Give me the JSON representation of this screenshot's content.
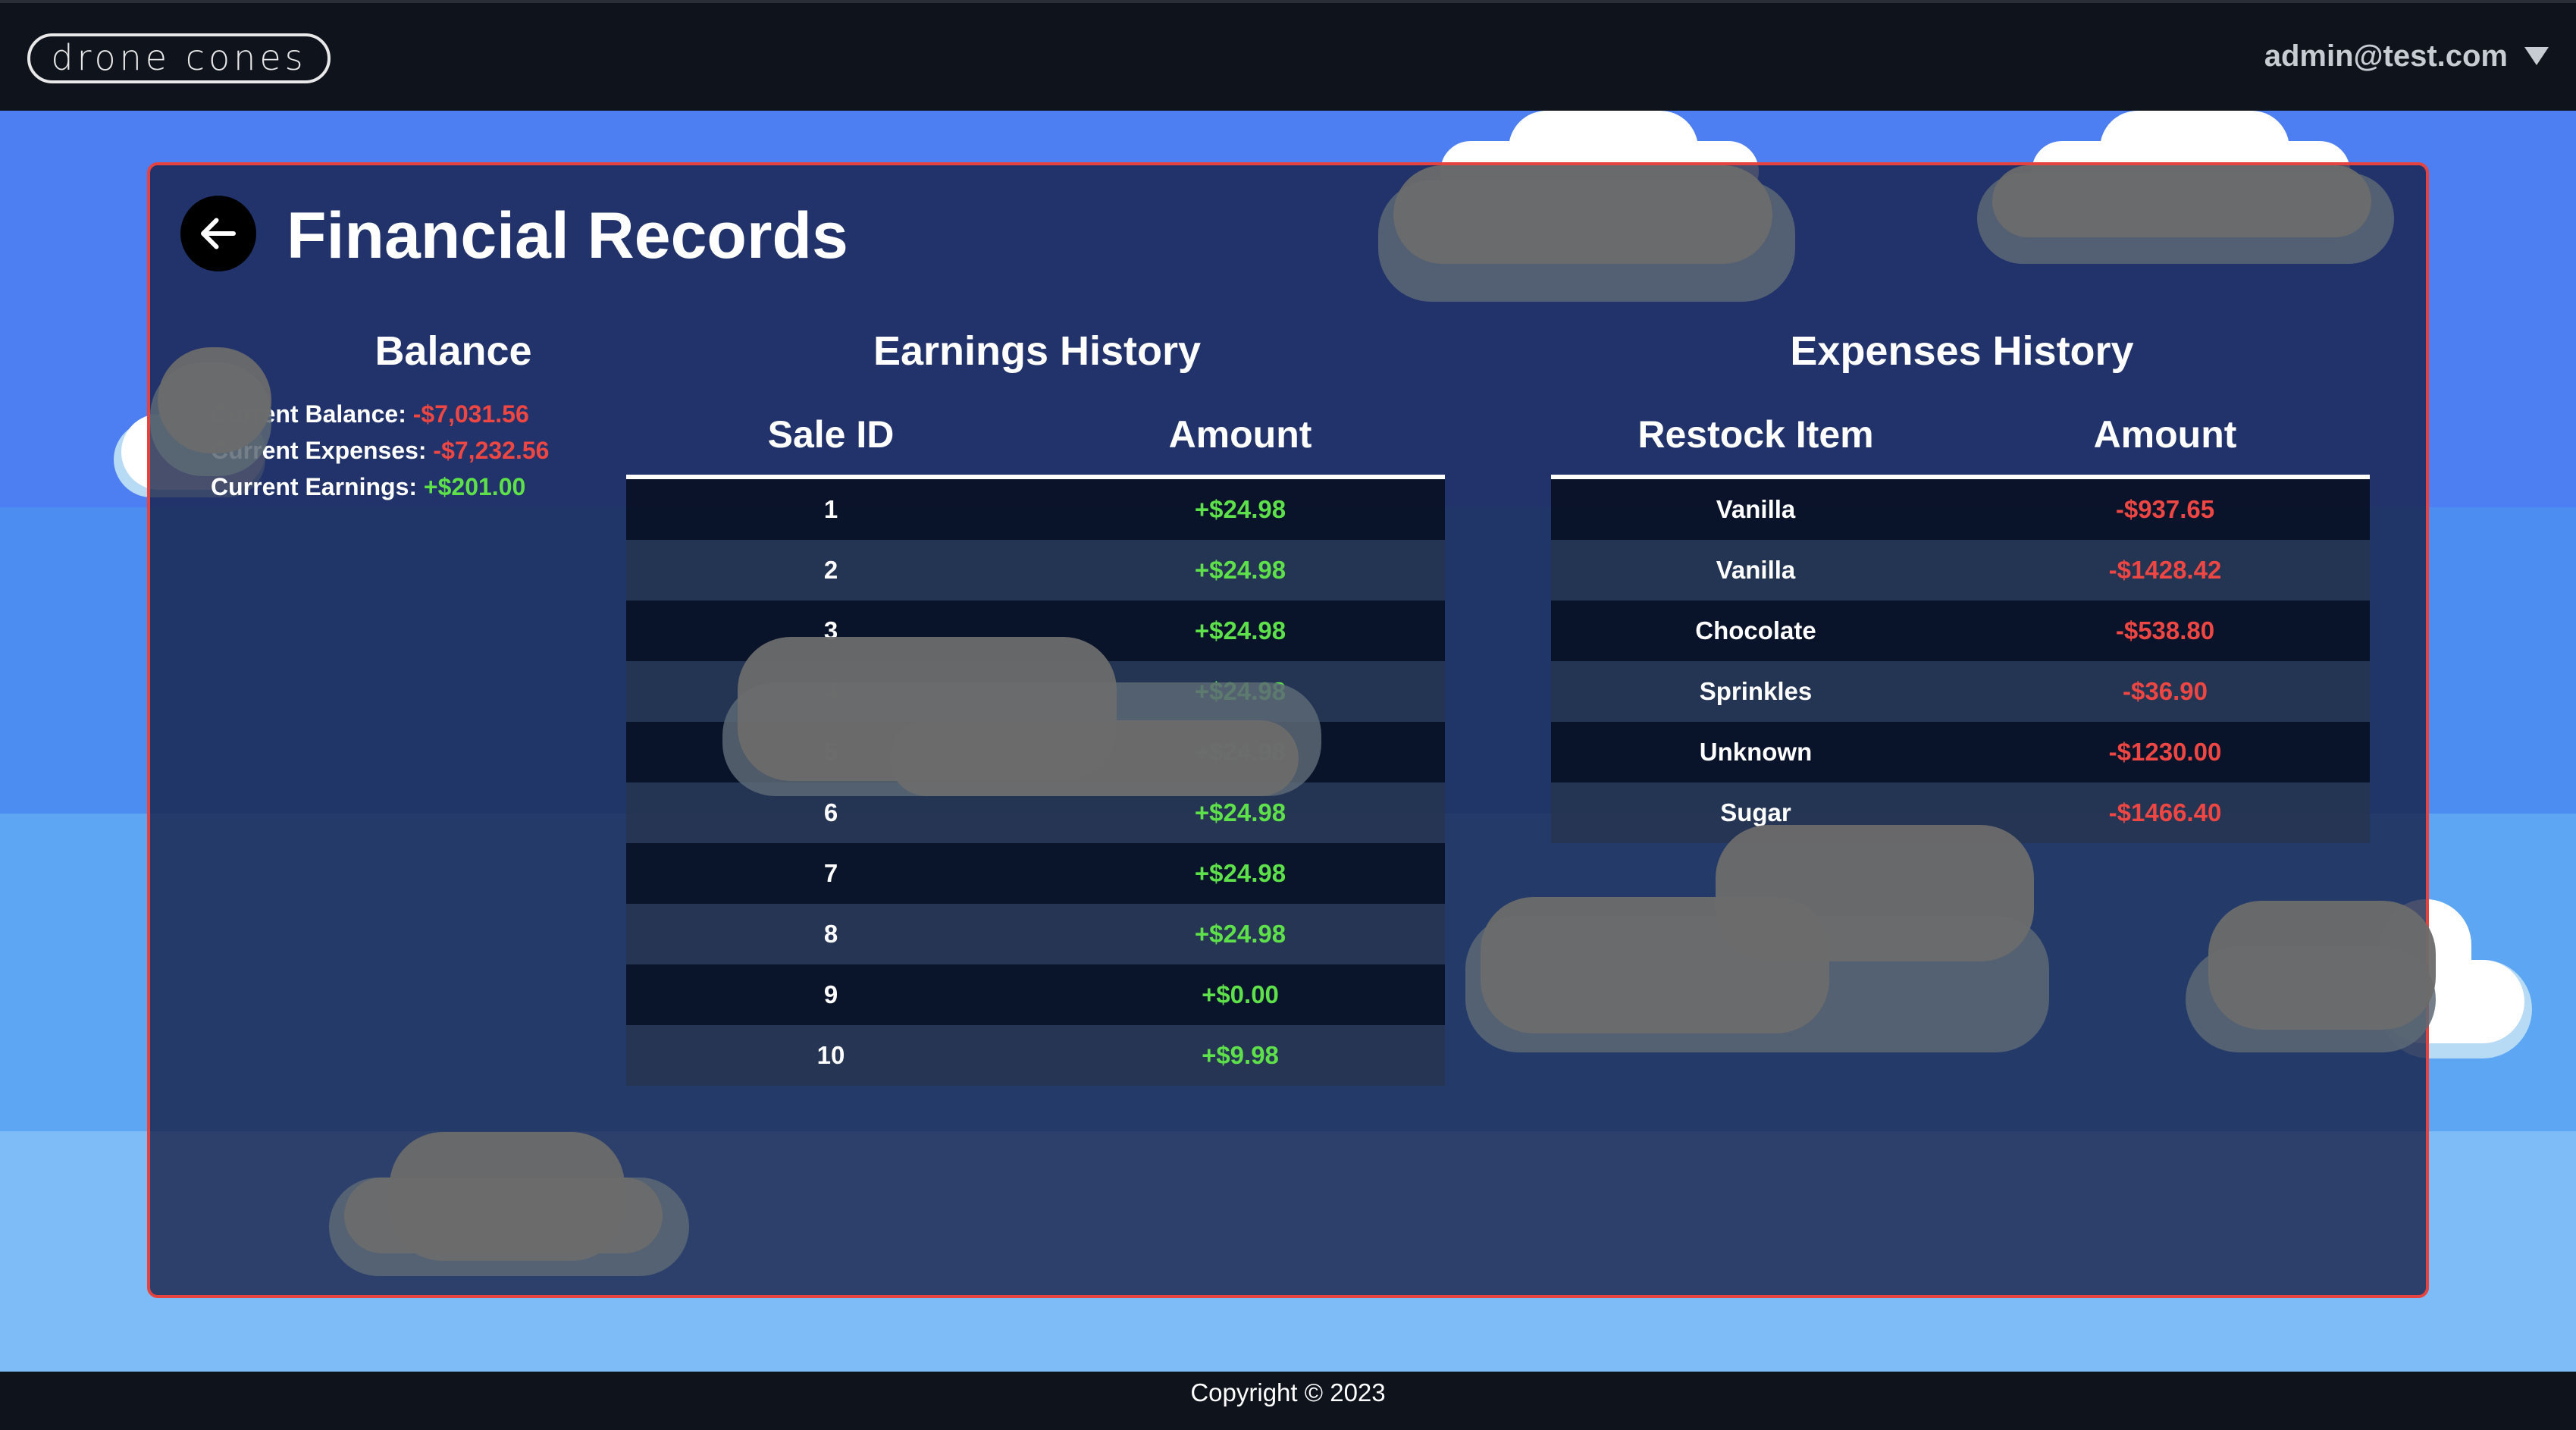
{
  "header": {
    "logo_text": "drone cones",
    "user_email": "admin@test.com",
    "dropdown_icon": "caret-down-icon"
  },
  "page": {
    "title": "Financial Records",
    "back_icon": "arrow-left-icon"
  },
  "balance": {
    "title": "Balance",
    "current_balance_label": "Current Balance:",
    "current_balance_value": "-$7,031.56",
    "current_expenses_label": "Current Expenses:",
    "current_expenses_value": "-$7,232.56",
    "current_earnings_label": "Current Earnings:",
    "current_earnings_value": "+$201.00"
  },
  "earnings": {
    "title": "Earnings History",
    "columns": [
      "Sale ID",
      "Amount"
    ],
    "rows": [
      {
        "id": "1",
        "amount": "+$24.98"
      },
      {
        "id": "2",
        "amount": "+$24.98"
      },
      {
        "id": "3",
        "amount": "+$24.98"
      },
      {
        "id": "4",
        "amount": "+$24.98"
      },
      {
        "id": "5",
        "amount": "+$24.98"
      },
      {
        "id": "6",
        "amount": "+$24.98"
      },
      {
        "id": "7",
        "amount": "+$24.98"
      },
      {
        "id": "8",
        "amount": "+$24.98"
      },
      {
        "id": "9",
        "amount": "+$0.00"
      },
      {
        "id": "10",
        "amount": "+$9.98"
      }
    ]
  },
  "expenses": {
    "title": "Expenses History",
    "columns": [
      "Restock Item",
      "Amount"
    ],
    "rows": [
      {
        "item": "Vanilla",
        "amount": "-$937.65"
      },
      {
        "item": "Vanilla",
        "amount": "-$1428.42"
      },
      {
        "item": "Chocolate",
        "amount": "-$538.80"
      },
      {
        "item": "Sprinkles",
        "amount": "-$36.90"
      },
      {
        "item": "Unknown",
        "amount": "-$1230.00"
      },
      {
        "item": "Sugar",
        "amount": "-$1466.40"
      }
    ]
  },
  "footer": {
    "copyright": "Copyright © 2023"
  },
  "colors": {
    "positive": "#5ee04a",
    "negative": "#ee4743",
    "panel_border": "#e5433f"
  }
}
